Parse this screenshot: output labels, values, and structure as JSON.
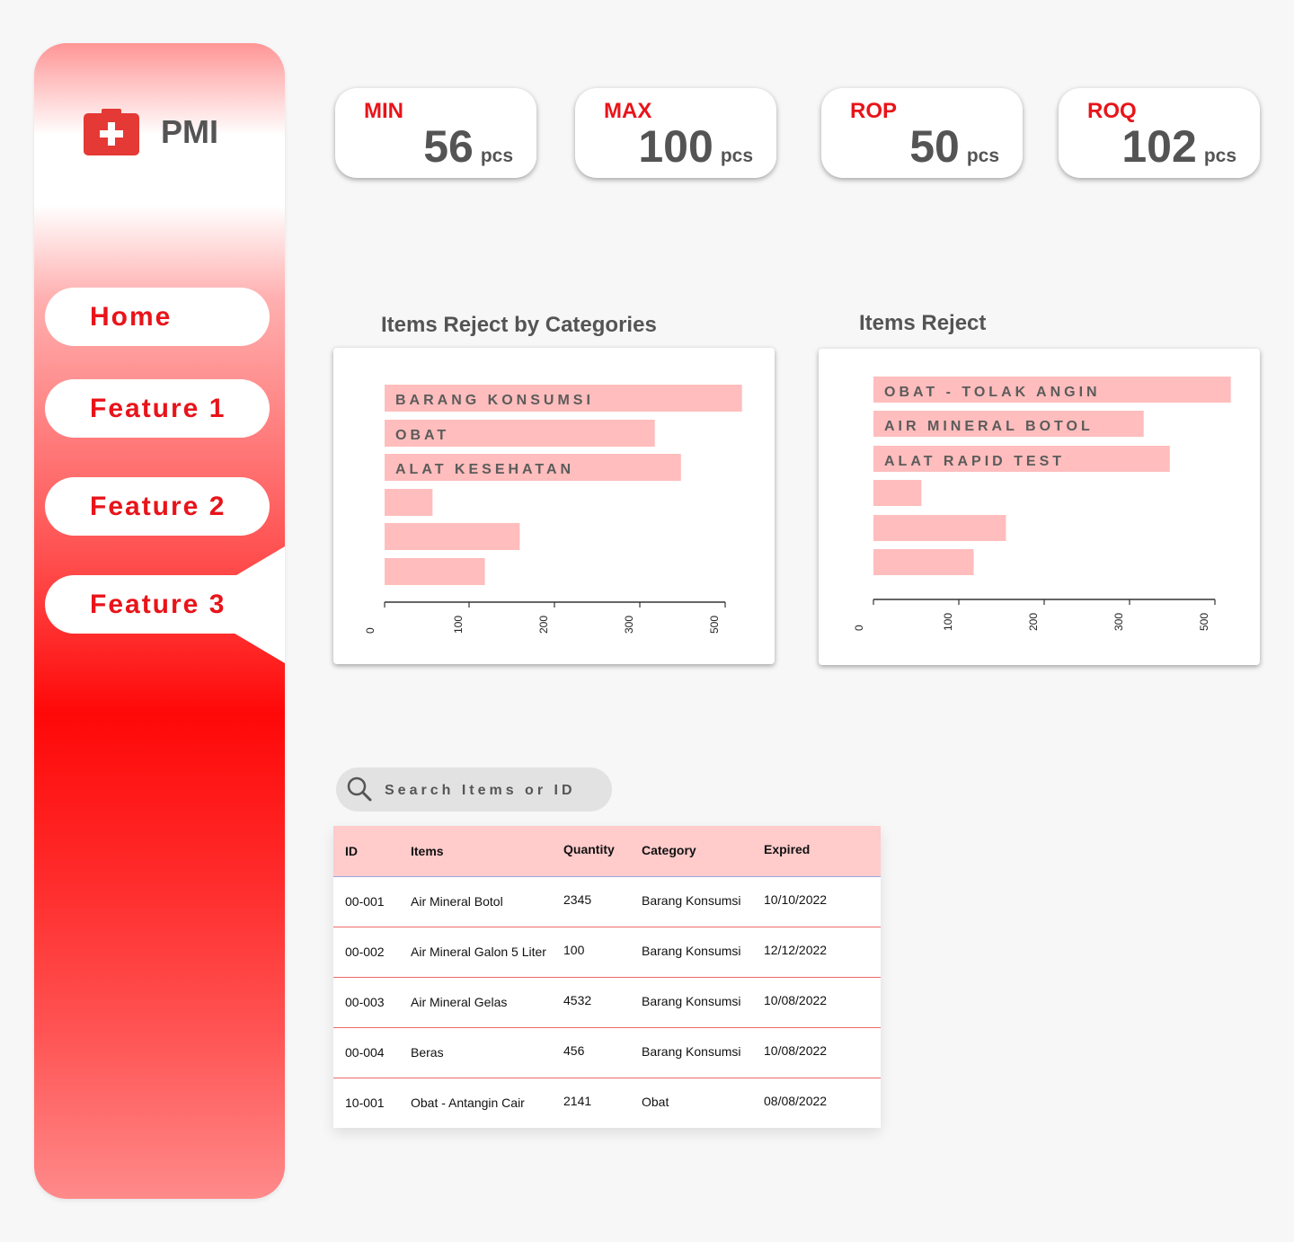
{
  "brand": {
    "name": "PMI"
  },
  "nav": [
    {
      "label": "Home"
    },
    {
      "label": "Feature 1"
    },
    {
      "label": "Feature 2"
    },
    {
      "label": "Feature 3",
      "active": true
    }
  ],
  "kpis": [
    {
      "label": "MIN",
      "value": "56",
      "unit": "pcs"
    },
    {
      "label": "MAX",
      "value": "100",
      "unit": "pcs"
    },
    {
      "label": "ROP",
      "value": "50",
      "unit": "pcs"
    },
    {
      "label": "ROQ",
      "value": "102",
      "unit": "pcs"
    }
  ],
  "charts": {
    "left_title": "Items Reject by Categories",
    "right_title": "Items Reject"
  },
  "chart_data": [
    {
      "type": "bar",
      "orientation": "horizontal",
      "title": "Items Reject by Categories",
      "categories": [
        "BARANG KONSUMSI",
        "OBAT",
        "ALAT KESEHATAN",
        "",
        "",
        ""
      ],
      "values": [
        410,
        310,
        340,
        55,
        155,
        115
      ],
      "x_ticks": [
        "0",
        "100",
        "200",
        "300",
        "500"
      ],
      "xlim": [
        0,
        400
      ],
      "bar_color": "#ffbdbd"
    },
    {
      "type": "bar",
      "orientation": "horizontal",
      "title": "Items Reject",
      "categories": [
        "OBAT - TOLAK ANGIN",
        "AIR MINERAL BOTOL",
        "ALAT RAPID TEST",
        "",
        "",
        ""
      ],
      "values": [
        410,
        310,
        340,
        55,
        152,
        115
      ],
      "x_ticks": [
        "0",
        "100",
        "200",
        "300",
        "500"
      ],
      "xlim": [
        0,
        400
      ],
      "bar_color": "#ffbdbd"
    }
  ],
  "search": {
    "placeholder": "Search Items or ID"
  },
  "table": {
    "columns": [
      "ID",
      "Items",
      "Quantity",
      "Category",
      "Expired"
    ],
    "rows": [
      [
        "00-001",
        " Air Mineral Botol",
        "2345",
        "Barang Konsumsi",
        "10/10/2022"
      ],
      [
        "00-002",
        "Air Mineral Galon 5 Liter",
        "100",
        "Barang Konsumsi",
        "12/12/2022"
      ],
      [
        "00-003",
        "Air Mineral Gelas",
        "4532",
        "Barang Konsumsi",
        "10/08/2022"
      ],
      [
        "00-004",
        "Beras",
        "456",
        "Barang Konsumsi",
        "10/08/2022"
      ],
      [
        "10-001",
        "Obat - Antangin Cair",
        "2141",
        "Obat",
        "08/08/2022"
      ]
    ]
  },
  "colors": {
    "accent": "#e8141a",
    "text_dark": "#545454",
    "bar": "#ffbdbd",
    "table_header": "#ffcbcb"
  },
  "icons": {
    "logo": "first-aid-kit-icon",
    "search": "search-icon"
  }
}
